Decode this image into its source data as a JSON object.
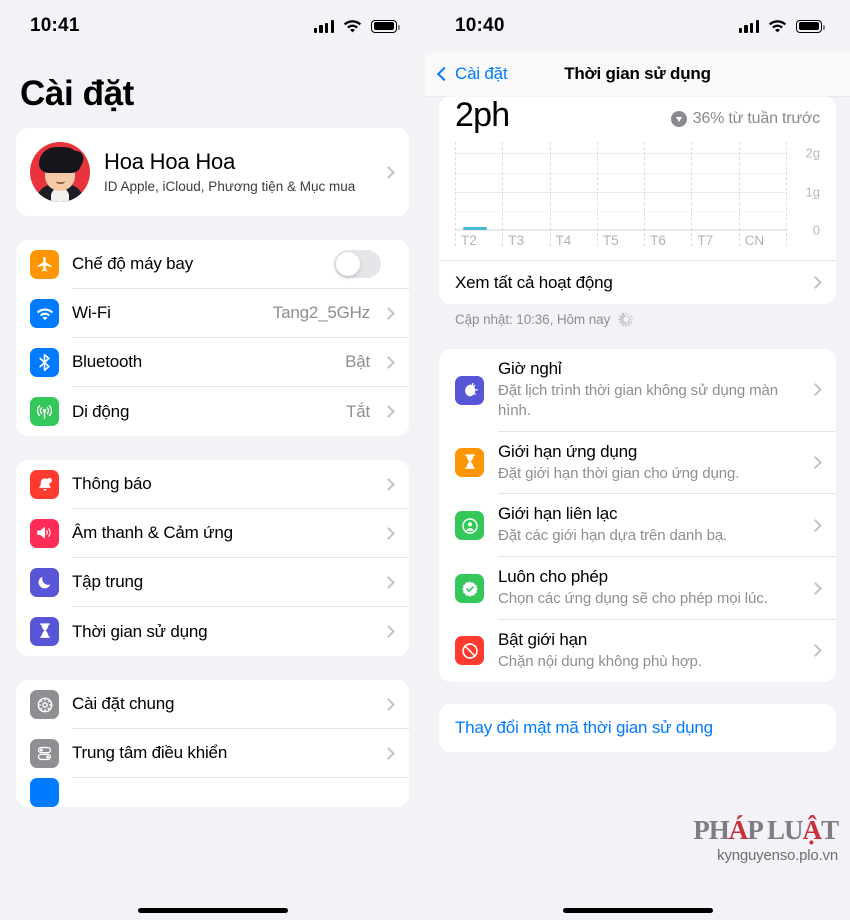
{
  "left": {
    "status": {
      "time": "10:41",
      "signal_icon": "cellular-bars-icon",
      "wifi_icon": "wifi-icon",
      "battery_icon": "battery-full-icon"
    },
    "page_title": "Cài đặt",
    "account": {
      "name": "Hoa Hoa Hoa",
      "subtitle": "ID Apple, iCloud, Phương tiện & Mục mua",
      "avatar": "user-avatar"
    },
    "group1": [
      {
        "label": "Chế độ máy bay",
        "icon": "airplane-icon",
        "color": "#FF9500",
        "control": "toggle",
        "toggle_on": false
      },
      {
        "label": "Wi-Fi",
        "icon": "wifi-icon",
        "color": "#007AFF",
        "value": "Tang2_5GHz",
        "control": "chevron"
      },
      {
        "label": "Bluetooth",
        "icon": "bluetooth-icon",
        "color": "#007AFF",
        "value": "Bật",
        "control": "chevron"
      },
      {
        "label": "Di động",
        "icon": "cellular-icon",
        "color": "#34C759",
        "value": "Tắt",
        "control": "chevron"
      }
    ],
    "group2": [
      {
        "label": "Thông báo",
        "icon": "bell-icon",
        "color": "#FF3B30",
        "control": "chevron"
      },
      {
        "label": "Âm thanh & Cảm ứng",
        "icon": "speaker-icon",
        "color": "#FF2D55",
        "control": "chevron"
      },
      {
        "label": "Tập trung",
        "icon": "moon-icon",
        "color": "#5856D6",
        "control": "chevron"
      },
      {
        "label": "Thời gian sử dụng",
        "icon": "hourglass-icon",
        "color": "#5856D6",
        "control": "chevron"
      }
    ],
    "group3": [
      {
        "label": "Cài đặt chung",
        "icon": "gear-icon",
        "color": "#8E8E93",
        "control": "chevron"
      },
      {
        "label": "Trung tâm điều khiển",
        "icon": "toggles-icon",
        "color": "#8E8E93",
        "control": "chevron"
      }
    ]
  },
  "right": {
    "status": {
      "time": "10:40",
      "signal_icon": "cellular-bars-icon",
      "wifi_icon": "wifi-icon",
      "battery_icon": "battery-full-icon"
    },
    "nav": {
      "back_label": "Cài đặt",
      "title": "Thời gian sử dụng"
    },
    "summary": {
      "total": "2ph",
      "delta": "36% từ tuần trước",
      "delta_icon": "arrow-down-circle-icon"
    },
    "all_activity": "Xem tất cả hoạt động",
    "updated": "Cập nhật: 10:36, Hôm nay",
    "features": [
      {
        "title": "Giờ nghỉ",
        "subtitle": "Đặt lịch trình thời gian không sử dụng màn hình.",
        "icon": "downtime-icon",
        "color": "#5856D6"
      },
      {
        "title": "Giới hạn ứng dụng",
        "subtitle": "Đặt giới hạn thời gian cho ứng dụng.",
        "icon": "hourglass-icon",
        "color": "#FF9500"
      },
      {
        "title": "Giới hạn liên lạc",
        "subtitle": "Đặt các giới hạn dựa trên danh bạ.",
        "icon": "person-circle-icon",
        "color": "#34C759"
      },
      {
        "title": "Luôn cho phép",
        "subtitle": "Chọn các ứng dụng sẽ cho phép mọi lúc.",
        "icon": "check-badge-icon",
        "color": "#34C759"
      },
      {
        "title": "Bật giới hạn",
        "subtitle": "Chặn nội dung không phù hợp.",
        "icon": "no-entry-icon",
        "color": "#FF3B30"
      }
    ],
    "passcode_link": "Thay đổi mật mã thời gian sử dụng",
    "watermark": {
      "logo_prefix": "PH",
      "logo_accent": "Á",
      "logo_mid": "P LU",
      "logo_accent2": "Ậ",
      "logo_suffix": "T",
      "url": "kynguyenso.plo.vn"
    }
  },
  "chart_data": {
    "type": "bar",
    "title": "2ph",
    "subtitle": "36% từ tuần trước",
    "categories": [
      "T2",
      "T3",
      "T4",
      "T5",
      "T6",
      "T7",
      "CN"
    ],
    "values": [
      0.03,
      0,
      0,
      0,
      0,
      0,
      0
    ],
    "ytick_labels": [
      "0",
      "1g",
      "2g"
    ],
    "ytick_values": [
      0,
      1,
      2
    ],
    "ylim": [
      0,
      2.3
    ],
    "xlabel": "",
    "ylabel": "",
    "grid": true,
    "legend": "none",
    "bar_color": "#4BB8D4"
  }
}
